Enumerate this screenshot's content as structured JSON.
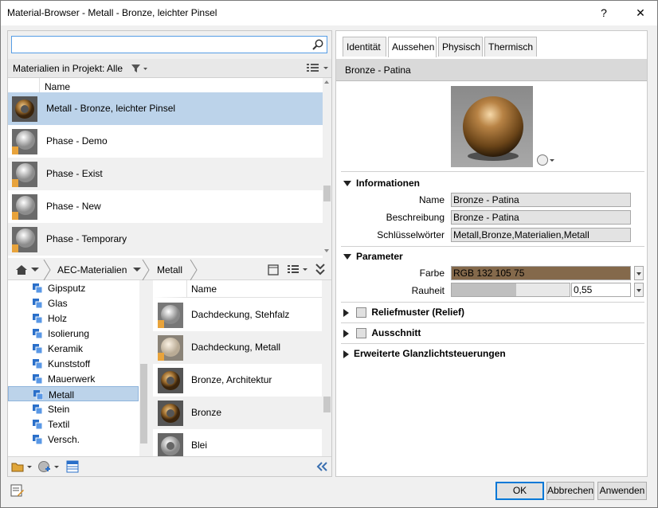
{
  "window": {
    "title": "Material-Browser - Metall - Bronze, leichter Pinsel",
    "help": "?",
    "close": "✕"
  },
  "search": {
    "value": "",
    "placeholder": ""
  },
  "filter": {
    "label": "Materialien in Projekt: Alle"
  },
  "project_list": {
    "header": "Name",
    "items": [
      {
        "label": "Metall - Bronze, leichter Pinsel",
        "selected": true,
        "icon": "bronze-torus"
      },
      {
        "label": "Phase - Demo",
        "icon": "gray-sphere"
      },
      {
        "label": "Phase - Exist",
        "icon": "gray-sphere"
      },
      {
        "label": "Phase - New",
        "icon": "gray-sphere"
      },
      {
        "label": "Phase - Temporary",
        "icon": "gray-sphere"
      }
    ]
  },
  "breadcrumb": {
    "library": "AEC-Materialien",
    "category": "Metall"
  },
  "categories": [
    {
      "label": "Gipsputz"
    },
    {
      "label": "Glas"
    },
    {
      "label": "Holz"
    },
    {
      "label": "Isolierung"
    },
    {
      "label": "Keramik"
    },
    {
      "label": "Kunststoff"
    },
    {
      "label": "Mauerwerk"
    },
    {
      "label": "Metall",
      "selected": true
    },
    {
      "label": "Stein"
    },
    {
      "label": "Textil"
    },
    {
      "label": "Versch."
    }
  ],
  "library_list": {
    "header": "Name",
    "items": [
      {
        "label": "Dachdeckung, Stehfalz",
        "icon": "silver-sphere"
      },
      {
        "label": "Dachdeckung, Metall",
        "icon": "beige-sphere"
      },
      {
        "label": "Bronze, Architektur",
        "icon": "bronze-torus"
      },
      {
        "label": "Bronze",
        "icon": "bronze-torus"
      },
      {
        "label": "Blei",
        "icon": "silver-torus"
      }
    ]
  },
  "tabs": [
    {
      "label": "Identität"
    },
    {
      "label": "Aussehen",
      "active": true
    },
    {
      "label": "Physisch"
    },
    {
      "label": "Thermisch"
    }
  ],
  "asset": {
    "name": "Bronze - Patina",
    "sections": {
      "info": "Informationen",
      "params": "Parameter",
      "relief": "Reliefmuster (Relief)",
      "cutout": "Ausschnitt",
      "highlight": "Erweiterte Glanzlichtsteuerungen"
    },
    "info": {
      "name_label": "Name",
      "name_value": "Bronze - Patina",
      "desc_label": "Beschreibung",
      "desc_value": "Bronze - Patina",
      "keywords_label": "Schlüsselwörter",
      "keywords_value": "Metall,Bronze,Materialien,Metall"
    },
    "params": {
      "color_label": "Farbe",
      "color_value": "RGB 132 105 75",
      "color_hex": "#84694b",
      "roughness_label": "Rauheit",
      "roughness_value": "0,55",
      "roughness_fraction": 0.55
    }
  },
  "buttons": {
    "ok": "OK",
    "cancel": "Abbrechen",
    "apply": "Anwenden"
  }
}
